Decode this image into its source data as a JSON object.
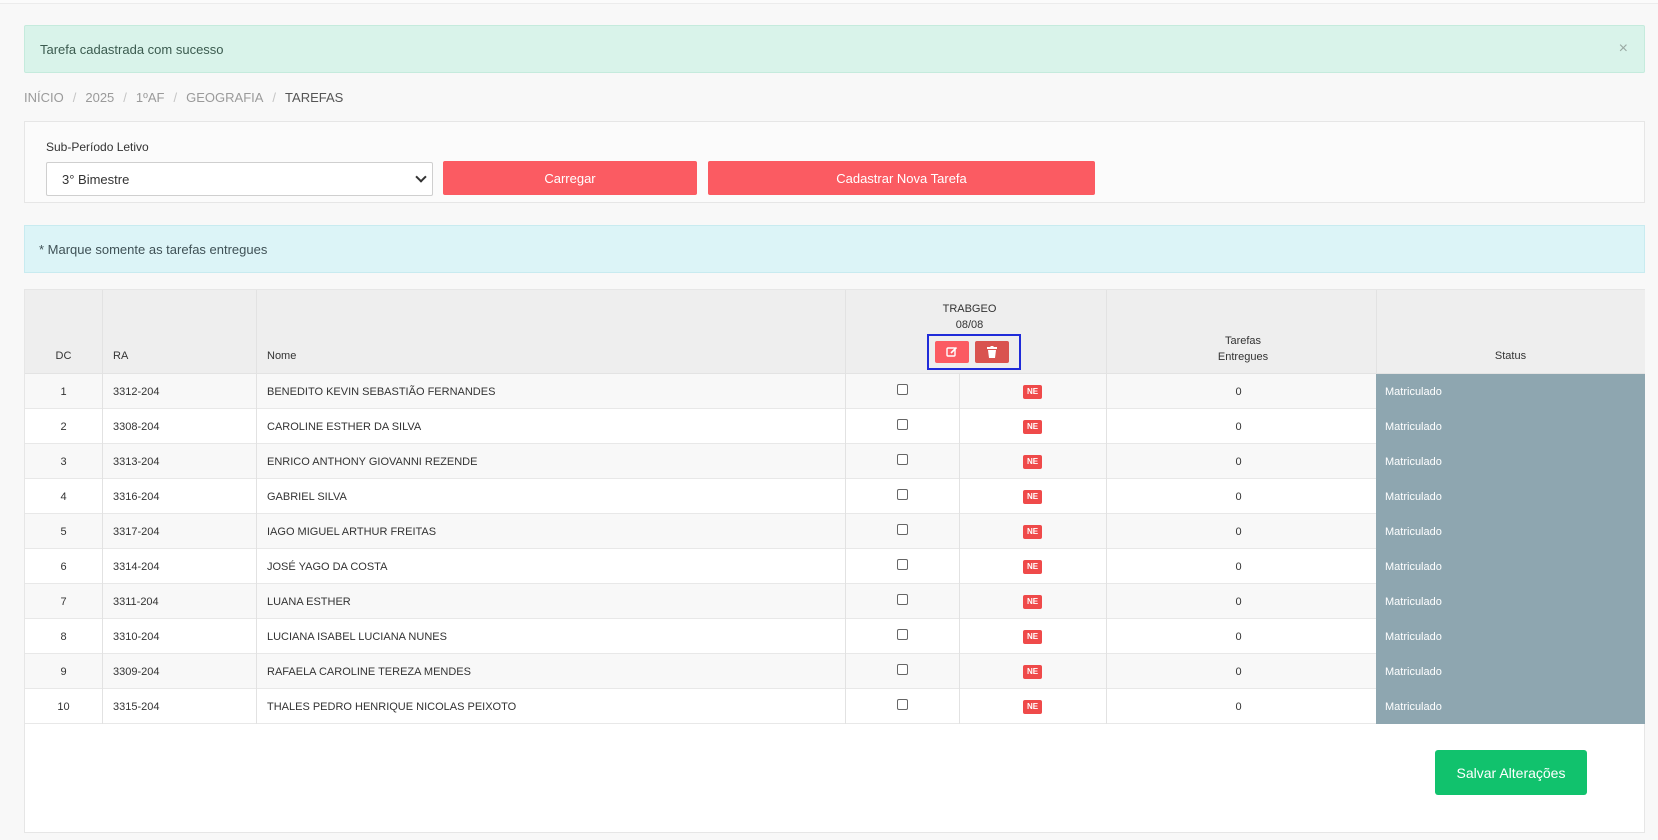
{
  "alert_success": {
    "text": "Tarefa cadastrada com sucesso",
    "close": "×"
  },
  "breadcrumb": [
    "INÍCIO",
    "2025",
    "1ºAF",
    "GEOGRAFIA",
    "TAREFAS"
  ],
  "breadcrumb_sep": "/",
  "filter": {
    "label": "Sub-Período Letivo",
    "selected": "3° Bimestre",
    "load_button": "Carregar",
    "new_task_button": "Cadastrar Nova Tarefa"
  },
  "alert_info": {
    "text": "* Marque somente as tarefas entregues"
  },
  "table": {
    "headers": {
      "dc": "DC",
      "ra": "RA",
      "nome": "Nome",
      "task_name": "TRABGEO",
      "task_date": "08/08",
      "entregues_line1": "Tarefas",
      "entregues_line2": "Entregues",
      "status": "Status"
    },
    "task_actions": {
      "edit_icon": "edit-icon",
      "delete_icon": "trash-icon"
    },
    "rows": [
      {
        "dc": "1",
        "ra": "3312-204",
        "nome": "BENEDITO KEVIN SEBASTIÃO FERNANDES",
        "checked": false,
        "badge": "NE",
        "entregues": "0",
        "status": "Matriculado"
      },
      {
        "dc": "2",
        "ra": "3308-204",
        "nome": "CAROLINE ESTHER DA SILVA",
        "checked": false,
        "badge": "NE",
        "entregues": "0",
        "status": "Matriculado"
      },
      {
        "dc": "3",
        "ra": "3313-204",
        "nome": "ENRICO ANTHONY GIOVANNI REZENDE",
        "checked": false,
        "badge": "NE",
        "entregues": "0",
        "status": "Matriculado"
      },
      {
        "dc": "4",
        "ra": "3316-204",
        "nome": "GABRIEL SILVA",
        "checked": false,
        "badge": "NE",
        "entregues": "0",
        "status": "Matriculado"
      },
      {
        "dc": "5",
        "ra": "3317-204",
        "nome": "IAGO MIGUEL ARTHUR FREITAS",
        "checked": false,
        "badge": "NE",
        "entregues": "0",
        "status": "Matriculado"
      },
      {
        "dc": "6",
        "ra": "3314-204",
        "nome": "JOSÉ YAGO DA COSTA",
        "checked": false,
        "badge": "NE",
        "entregues": "0",
        "status": "Matriculado"
      },
      {
        "dc": "7",
        "ra": "3311-204",
        "nome": "LUANA ESTHER",
        "checked": false,
        "badge": "NE",
        "entregues": "0",
        "status": "Matriculado"
      },
      {
        "dc": "8",
        "ra": "3310-204",
        "nome": "LUCIANA ISABEL LUCIANA NUNES",
        "checked": false,
        "badge": "NE",
        "entregues": "0",
        "status": "Matriculado"
      },
      {
        "dc": "9",
        "ra": "3309-204",
        "nome": "RAFAELA CAROLINE TEREZA MENDES",
        "checked": false,
        "badge": "NE",
        "entregues": "0",
        "status": "Matriculado"
      },
      {
        "dc": "10",
        "ra": "3315-204",
        "nome": "THALES PEDRO HENRIQUE NICOLAS PEIXOTO",
        "checked": false,
        "badge": "NE",
        "entregues": "0",
        "status": "Matriculado"
      }
    ]
  },
  "save_button": "Salvar Alterações",
  "colors": {
    "accent_red": "#fb5b62",
    "delete_red": "#d9534f",
    "success_green": "#11c26d",
    "status_bg": "#8ea6b0",
    "highlight_box": "#1f2bd9"
  }
}
